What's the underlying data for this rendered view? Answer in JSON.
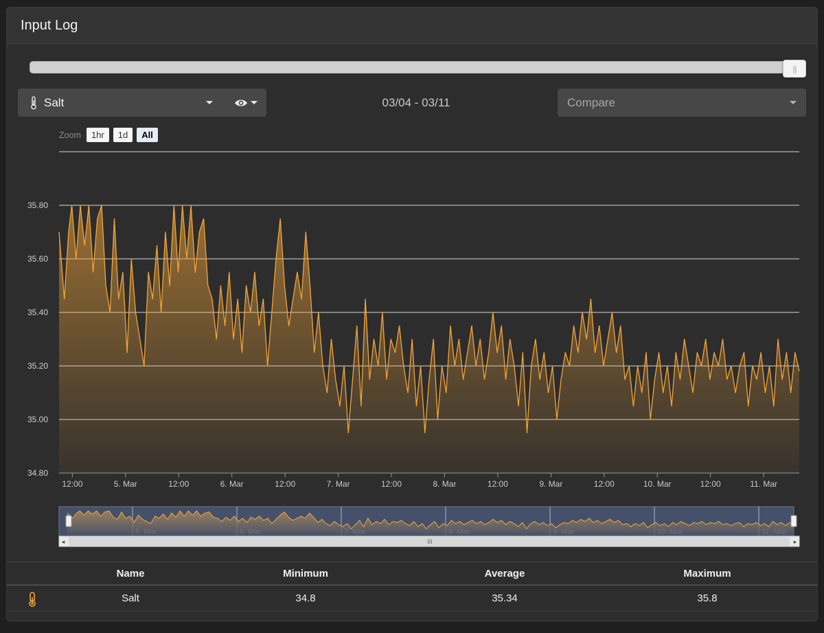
{
  "panel": {
    "title": "Input Log"
  },
  "time_slider": {
    "value": 1.0
  },
  "input_select": {
    "label": "Salt",
    "icon": "thermometer-icon"
  },
  "visibility": {
    "icon": "eye-icon"
  },
  "date_range": "03/04 - 03/11",
  "compare": {
    "placeholder": "Compare"
  },
  "zoom": {
    "label": "Zoom",
    "buttons": [
      "1hr",
      "1d",
      "All"
    ],
    "active": "All"
  },
  "colors": {
    "series": "#f3a537",
    "background": "#2d2d2d",
    "grid": "#d9d9d9",
    "navigator_fill": "#45516a"
  },
  "chart_data": {
    "type": "area",
    "x_start": "2024-03-04T09:00",
    "x_end": "2024-03-11T17:00",
    "xticks": [
      {
        "t": 0.125,
        "label": "12:00"
      },
      {
        "t": 0.625,
        "label": "5. Mar"
      },
      {
        "t": 1.125,
        "label": "12:00"
      },
      {
        "t": 1.625,
        "label": "6. Mar"
      },
      {
        "t": 2.125,
        "label": "12:00"
      },
      {
        "t": 2.625,
        "label": "7. Mar"
      },
      {
        "t": 3.125,
        "label": "12:00"
      },
      {
        "t": 3.625,
        "label": "8. Mar"
      },
      {
        "t": 4.125,
        "label": "12:00"
      },
      {
        "t": 4.625,
        "label": "9. Mar"
      },
      {
        "t": 5.125,
        "label": "12:00"
      },
      {
        "t": 5.625,
        "label": "10. Mar"
      },
      {
        "t": 6.125,
        "label": "12:00"
      },
      {
        "t": 6.625,
        "label": "11. Mar"
      }
    ],
    "yticks": [
      "34.80",
      "35.00",
      "35.20",
      "35.40",
      "35.60",
      "35.80"
    ],
    "ylim": [
      34.8,
      36.0
    ],
    "series": [
      {
        "name": "Salt",
        "t_end": 6.96,
        "points": [
          [
            0.0,
            35.7
          ],
          [
            0.05,
            35.45
          ],
          [
            0.09,
            35.7
          ],
          [
            0.12,
            35.8
          ],
          [
            0.16,
            35.6
          ],
          [
            0.2,
            35.8
          ],
          [
            0.24,
            35.65
          ],
          [
            0.28,
            35.8
          ],
          [
            0.32,
            35.55
          ],
          [
            0.36,
            35.75
          ],
          [
            0.4,
            35.8
          ],
          [
            0.44,
            35.5
          ],
          [
            0.48,
            35.4
          ],
          [
            0.52,
            35.75
          ],
          [
            0.56,
            35.45
          ],
          [
            0.6,
            35.55
          ],
          [
            0.64,
            35.25
          ],
          [
            0.68,
            35.6
          ],
          [
            0.72,
            35.4
          ],
          [
            0.76,
            35.3
          ],
          [
            0.8,
            35.2
          ],
          [
            0.84,
            35.55
          ],
          [
            0.88,
            35.45
          ],
          [
            0.92,
            35.65
          ],
          [
            0.96,
            35.4
          ],
          [
            1.0,
            35.7
          ],
          [
            1.04,
            35.5
          ],
          [
            1.08,
            35.8
          ],
          [
            1.12,
            35.55
          ],
          [
            1.16,
            35.8
          ],
          [
            1.2,
            35.6
          ],
          [
            1.24,
            35.8
          ],
          [
            1.28,
            35.55
          ],
          [
            1.32,
            35.7
          ],
          [
            1.36,
            35.75
          ],
          [
            1.4,
            35.5
          ],
          [
            1.44,
            35.45
          ],
          [
            1.48,
            35.3
          ],
          [
            1.52,
            35.5
          ],
          [
            1.56,
            35.35
          ],
          [
            1.6,
            35.55
          ],
          [
            1.64,
            35.3
          ],
          [
            1.68,
            35.45
          ],
          [
            1.72,
            35.25
          ],
          [
            1.76,
            35.5
          ],
          [
            1.8,
            35.4
          ],
          [
            1.84,
            35.55
          ],
          [
            1.88,
            35.35
          ],
          [
            1.92,
            35.45
          ],
          [
            1.96,
            35.2
          ],
          [
            2.0,
            35.4
          ],
          [
            2.04,
            35.6
          ],
          [
            2.08,
            35.75
          ],
          [
            2.12,
            35.5
          ],
          [
            2.16,
            35.35
          ],
          [
            2.2,
            35.45
          ],
          [
            2.24,
            35.55
          ],
          [
            2.28,
            35.45
          ],
          [
            2.32,
            35.7
          ],
          [
            2.36,
            35.5
          ],
          [
            2.4,
            35.25
          ],
          [
            2.44,
            35.4
          ],
          [
            2.48,
            35.2
          ],
          [
            2.52,
            35.1
          ],
          [
            2.56,
            35.3
          ],
          [
            2.6,
            35.15
          ],
          [
            2.64,
            35.05
          ],
          [
            2.68,
            35.2
          ],
          [
            2.72,
            34.95
          ],
          [
            2.76,
            35.15
          ],
          [
            2.8,
            35.35
          ],
          [
            2.84,
            35.05
          ],
          [
            2.88,
            35.45
          ],
          [
            2.92,
            35.15
          ],
          [
            2.96,
            35.3
          ],
          [
            3.0,
            35.2
          ],
          [
            3.04,
            35.4
          ],
          [
            3.08,
            35.15
          ],
          [
            3.12,
            35.3
          ],
          [
            3.16,
            35.25
          ],
          [
            3.2,
            35.35
          ],
          [
            3.24,
            35.2
          ],
          [
            3.28,
            35.1
          ],
          [
            3.32,
            35.3
          ],
          [
            3.36,
            35.05
          ],
          [
            3.4,
            35.2
          ],
          [
            3.44,
            34.95
          ],
          [
            3.48,
            35.15
          ],
          [
            3.52,
            35.3
          ],
          [
            3.56,
            35.0
          ],
          [
            3.6,
            35.2
          ],
          [
            3.64,
            35.1
          ],
          [
            3.68,
            35.35
          ],
          [
            3.72,
            35.2
          ],
          [
            3.76,
            35.3
          ],
          [
            3.8,
            35.15
          ],
          [
            3.84,
            35.25
          ],
          [
            3.88,
            35.35
          ],
          [
            3.92,
            35.2
          ],
          [
            3.96,
            35.3
          ],
          [
            4.0,
            35.15
          ],
          [
            4.04,
            35.25
          ],
          [
            4.08,
            35.4
          ],
          [
            4.12,
            35.25
          ],
          [
            4.16,
            35.35
          ],
          [
            4.2,
            35.15
          ],
          [
            4.24,
            35.3
          ],
          [
            4.28,
            35.2
          ],
          [
            4.32,
            35.05
          ],
          [
            4.36,
            35.25
          ],
          [
            4.4,
            34.95
          ],
          [
            4.44,
            35.2
          ],
          [
            4.48,
            35.3
          ],
          [
            4.52,
            35.15
          ],
          [
            4.56,
            35.25
          ],
          [
            4.6,
            35.1
          ],
          [
            4.64,
            35.2
          ],
          [
            4.68,
            35.0
          ],
          [
            4.72,
            35.15
          ],
          [
            4.76,
            35.25
          ],
          [
            4.8,
            35.2
          ],
          [
            4.84,
            35.35
          ],
          [
            4.88,
            35.25
          ],
          [
            4.92,
            35.4
          ],
          [
            4.96,
            35.3
          ],
          [
            5.0,
            35.45
          ],
          [
            5.04,
            35.25
          ],
          [
            5.08,
            35.35
          ],
          [
            5.12,
            35.2
          ],
          [
            5.16,
            35.3
          ],
          [
            5.2,
            35.4
          ],
          [
            5.24,
            35.25
          ],
          [
            5.28,
            35.35
          ],
          [
            5.32,
            35.15
          ],
          [
            5.36,
            35.2
          ],
          [
            5.4,
            35.05
          ],
          [
            5.44,
            35.2
          ],
          [
            5.48,
            35.1
          ],
          [
            5.52,
            35.25
          ],
          [
            5.56,
            35.0
          ],
          [
            5.6,
            35.15
          ],
          [
            5.64,
            35.25
          ],
          [
            5.68,
            35.1
          ],
          [
            5.72,
            35.2
          ],
          [
            5.76,
            35.05
          ],
          [
            5.8,
            35.25
          ],
          [
            5.84,
            35.15
          ],
          [
            5.88,
            35.3
          ],
          [
            5.92,
            35.2
          ],
          [
            5.96,
            35.1
          ],
          [
            6.0,
            35.25
          ],
          [
            6.04,
            35.2
          ],
          [
            6.08,
            35.3
          ],
          [
            6.12,
            35.15
          ],
          [
            6.16,
            35.25
          ],
          [
            6.2,
            35.2
          ],
          [
            6.24,
            35.3
          ],
          [
            6.28,
            35.15
          ],
          [
            6.32,
            35.2
          ],
          [
            6.36,
            35.1
          ],
          [
            6.4,
            35.2
          ],
          [
            6.44,
            35.25
          ],
          [
            6.48,
            35.05
          ],
          [
            6.52,
            35.2
          ],
          [
            6.56,
            35.15
          ],
          [
            6.6,
            35.25
          ],
          [
            6.64,
            35.1
          ],
          [
            6.68,
            35.2
          ],
          [
            6.72,
            35.05
          ],
          [
            6.76,
            35.3
          ],
          [
            6.8,
            35.15
          ],
          [
            6.84,
            35.25
          ],
          [
            6.88,
            35.1
          ],
          [
            6.92,
            35.25
          ],
          [
            6.96,
            35.18
          ]
        ]
      }
    ]
  },
  "navigator": {
    "labels": [
      {
        "t": 0.625,
        "label": "5. Mar"
      },
      {
        "t": 1.625,
        "label": "6. Mar"
      },
      {
        "t": 2.625,
        "label": "7. Mar"
      },
      {
        "t": 3.625,
        "label": "8. Mar"
      },
      {
        "t": 4.625,
        "label": "9. Mar"
      },
      {
        "t": 5.625,
        "label": "10. Mar"
      },
      {
        "t": 6.625,
        "label": "11. Mar"
      }
    ]
  },
  "table": {
    "headers": [
      "Name",
      "Minimum",
      "Average",
      "Maximum"
    ],
    "rows": [
      {
        "icon": "thermometer-icon",
        "name": "Salt",
        "minimum": "34.8",
        "average": "35.34",
        "maximum": "35.8"
      }
    ]
  }
}
